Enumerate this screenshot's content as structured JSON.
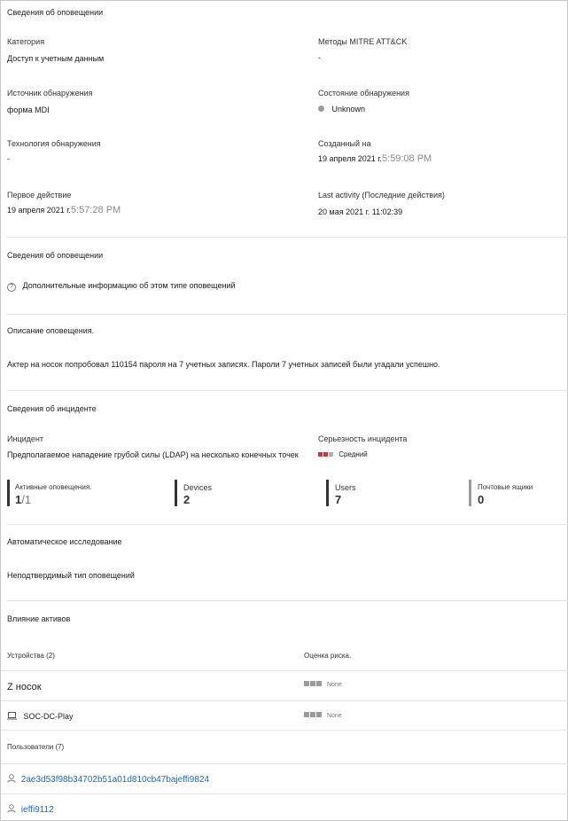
{
  "alert_details": {
    "title": "Сведения об оповещении",
    "category_label": "Категория",
    "category_value": "Доступ к учетным данным",
    "mitre_label": "Методы MITRE ATT&CK",
    "mitre_value": "-",
    "source_label": "Источник обнаружения",
    "source_value": "форма MDI",
    "state_label": "Состояние обнаружения",
    "state_value": "Unknown",
    "tech_label": "Технология обнаружения",
    "tech_value": "-",
    "created_label": "Созданный на",
    "created_date": "19 апреля 2021 г.",
    "created_time": "5:59:08 PM",
    "first_label": "Первое действие",
    "first_date": "19 апреля 2021 г.",
    "first_time": "5:57:28 PM",
    "last_label": "Last activity (Последние действия)",
    "last_value": "20 мая 2021 г. 11:02:39"
  },
  "alert_info": {
    "title": "Сведения об оповещении",
    "more_info": "Дополнительные информацию об этом типе оповещений"
  },
  "description": {
    "title": "Описание оповещения.",
    "text": "Актер на носок попробовал 110154 пароля на 7 учетных записях. Пароли 7 учетных записей были угадали успешно."
  },
  "incident": {
    "title": "Сведения об инциденте",
    "incident_label": "Инцидент",
    "incident_value": "Предполагаемое нападение грубой силы (LDAP) на несколько конечных точек",
    "severity_label": "Серьезность инцидента",
    "severity_value": "Средний",
    "stats": [
      {
        "label": "Активные оповещения.",
        "value": "1",
        "suffix": "/1"
      },
      {
        "label": "Devices",
        "value": "2"
      },
      {
        "label": "Users",
        "value": "7"
      },
      {
        "label": "Почтовые ящики",
        "value": "0"
      }
    ]
  },
  "auto_investigation": {
    "title": "Автоматическое исследование",
    "text": "Неподтвердимый тип оповещений"
  },
  "assets": {
    "title": "Влияние активов",
    "devices_header": "Устройства (2)",
    "risk_header": "Оценка риска.",
    "devices": [
      {
        "name": "Z носок",
        "risk": "None"
      },
      {
        "name": "SOC-DC-Play",
        "risk": "None"
      }
    ],
    "users_header": "Пользователи (7)",
    "users": [
      "2ae3d53f98b34702b51a01d810cb47bajeffi9824",
      "ieffi9112"
    ]
  },
  "colors": {
    "severity_red": "#d13438",
    "severity_gray": "#b0b0b0",
    "link": "#1a6ab5"
  }
}
